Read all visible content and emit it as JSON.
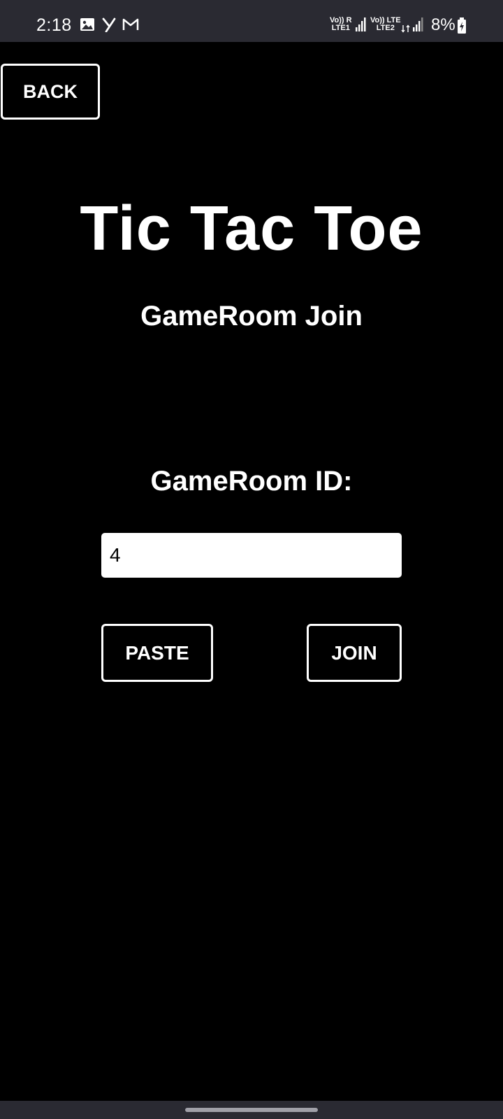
{
  "status_bar": {
    "time": "2:18",
    "notification_icons": [
      "image-icon",
      "y-app-icon",
      "gmail-icon"
    ],
    "sim1_label_top": "Vo)) R",
    "sim1_label_bottom": "LTE1",
    "sim2_label_top": "Vo)) LTE",
    "sim2_label_bottom": "LTE2",
    "battery_percent": "8%",
    "battery_charging": true
  },
  "header": {
    "back_label": "BACK"
  },
  "main": {
    "title": "Tic Tac Toe",
    "subtitle": "GameRoom Join",
    "id_label": "GameRoom ID:",
    "id_value": "4",
    "paste_label": "PASTE",
    "join_label": "JOIN"
  },
  "colors": {
    "background": "#000000",
    "foreground": "#ffffff",
    "status_bar": "#2a2a32"
  }
}
